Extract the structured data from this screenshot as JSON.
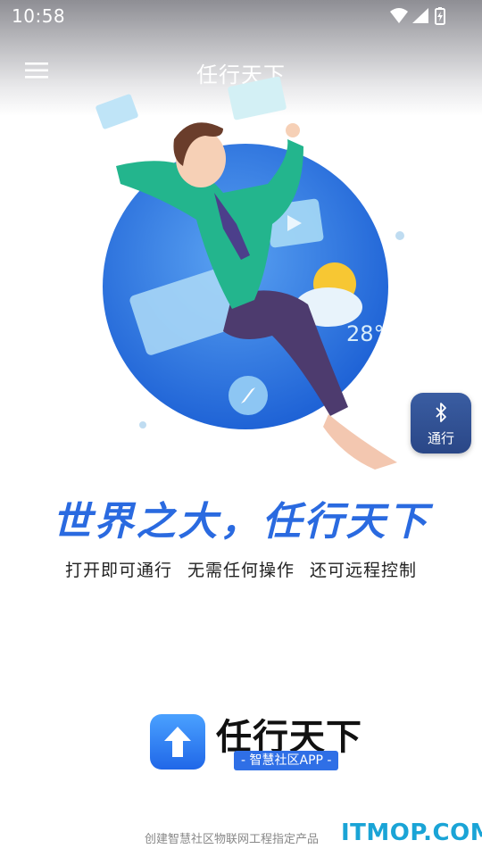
{
  "status_bar": {
    "time": "10:58"
  },
  "app_bar": {
    "title": "任行天下"
  },
  "hero": {
    "weather_temp": "28°"
  },
  "bluetooth_button": {
    "label": "通行"
  },
  "slogan": "世界之大，任行天下",
  "subline": "打开即可通行 无需任何操作 还可远程控制",
  "logo": {
    "name": "任行天下",
    "subtitle": "- 智慧社区APP -"
  },
  "footer": {
    "text": "创建智慧社区物联网工程指定产品"
  },
  "watermark": "ITMOP.COM",
  "colors": {
    "accent": "#2a6ae0",
    "bt_button": "#2f4e91",
    "watermark": "#1aa4d6"
  }
}
